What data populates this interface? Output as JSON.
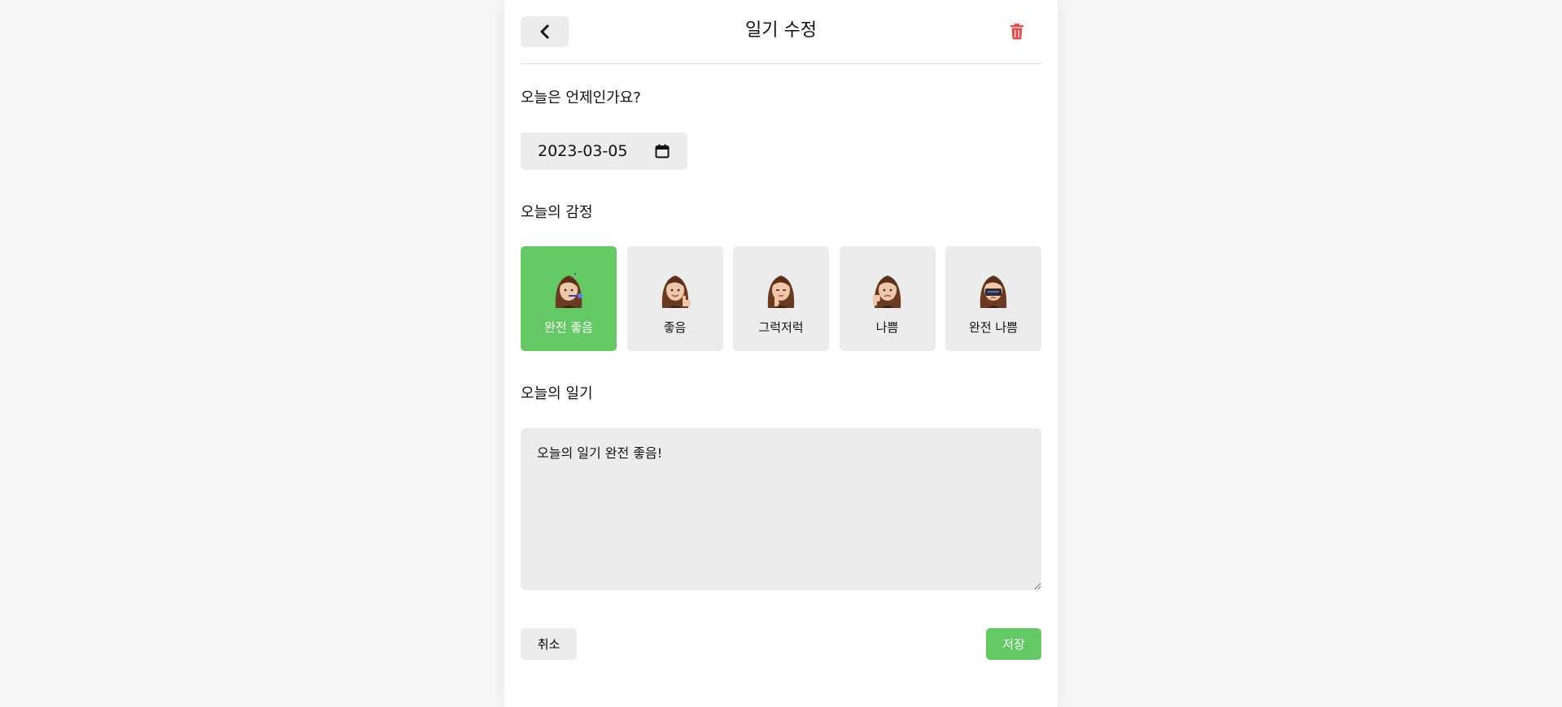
{
  "header": {
    "title": "일기 수정",
    "back_icon": "chevron-left-icon",
    "delete_icon": "trash-icon",
    "delete_color": "#e84a4a"
  },
  "date_section": {
    "label": "오늘은 언제인가요?",
    "value": "2023-03-05",
    "icon": "calendar-icon"
  },
  "emotion_section": {
    "label": "오늘의 감정",
    "selected_color": "#64c964",
    "items": [
      {
        "label": "완전 좋음",
        "selected": true
      },
      {
        "label": "좋음",
        "selected": false
      },
      {
        "label": "그럭저럭",
        "selected": false
      },
      {
        "label": "나쁨",
        "selected": false
      },
      {
        "label": "완전 나쁨",
        "selected": false
      }
    ]
  },
  "diary_section": {
    "label": "오늘의 일기",
    "content": "오늘의 일기 완전 좋음!"
  },
  "actions": {
    "cancel_label": "취소",
    "save_label": "저장"
  }
}
